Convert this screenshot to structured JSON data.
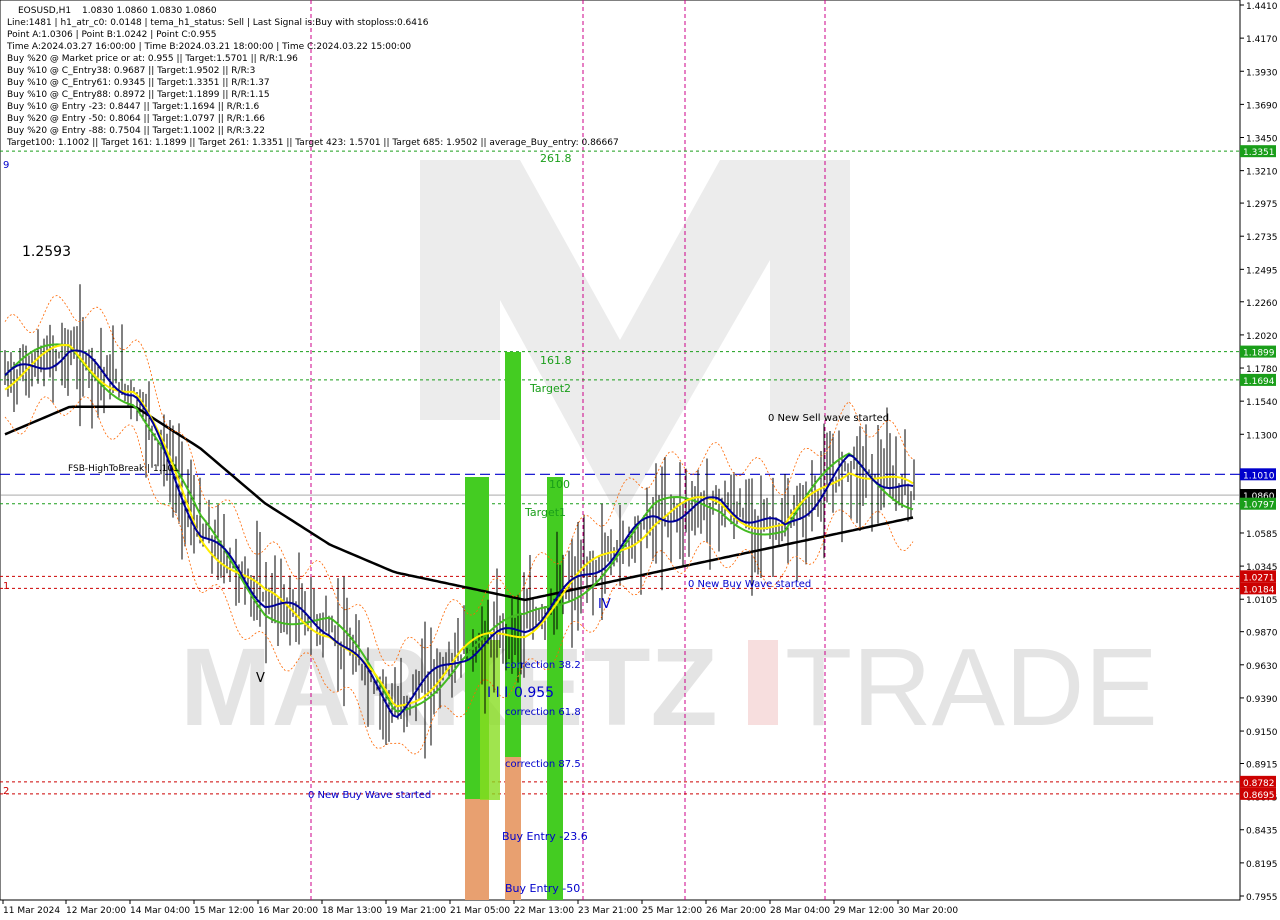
{
  "header": {
    "symbol": "EOSUSD,H1",
    "ohlc": "1.0830 1.0860 1.0830 1.0860",
    "lines": [
      "Line:1481 | h1_atr_c0: 0.0148 | tema_h1_status: Sell | Last Signal is:Buy with stoploss:0.6416",
      "Point A:1.0306 | Point B:1.0242 | Point C:0.955",
      "Time A:2024.03.27 16:00:00 | Time B:2024.03.21 18:00:00 | Time C:2024.03.22 15:00:00",
      "Buy %20 @ Market price or at: 0.955 || Target:1.5701 || R/R:1.96",
      "Buy %10 @ C_Entry38: 0.9687 || Target:1.9502 || R/R:3",
      "Buy %10 @ C_Entry61: 0.9345 || Target:1.3351 || R/R:1.37",
      "Buy %10 @ C_Entry88: 0.8972 || Target:1.1899 || R/R:1.15",
      "Buy %10 @ Entry -23: 0.8447 || Target:1.1694 || R/R:1.6",
      "Buy %20 @ Entry -50: 0.8064 || Target:1.0797 || R/R:1.66",
      "Buy %20 @ Entry -88: 0.7504 || Target:1.1002 || R/R:3.22",
      "Target100: 1.1002 || Target 161: 1.1899 || Target 261: 1.3351 || Target 423: 1.5701 || Target 685: 1.9502 || average_Buy_entry: 0.86667"
    ]
  },
  "colors": {
    "price_box": "#000000",
    "green_box": "#1a9e1a",
    "red_box": "#cc0000",
    "blue_box": "#0000cc",
    "bar_green": "#44cc22",
    "bar_orange": "#e8a070",
    "bar_lime": "#88dd22"
  },
  "price_labels": [
    {
      "value": 1.441,
      "text": "1.4410"
    },
    {
      "value": 1.417,
      "text": "1.4170"
    },
    {
      "value": 1.393,
      "text": "1.3930"
    },
    {
      "value": 1.369,
      "text": "1.3690"
    },
    {
      "value": 1.345,
      "text": "1.3450"
    },
    {
      "value": 1.321,
      "text": "1.3210"
    },
    {
      "value": 1.2975,
      "text": "1.2975"
    },
    {
      "value": 1.2735,
      "text": "1.2735"
    },
    {
      "value": 1.2495,
      "text": "1.2495"
    },
    {
      "value": 1.226,
      "text": "1.2260"
    },
    {
      "value": 1.202,
      "text": "1.2020"
    },
    {
      "value": 1.178,
      "text": "1.1780"
    },
    {
      "value": 1.154,
      "text": "1.1540"
    },
    {
      "value": 1.13,
      "text": "1.1300"
    },
    {
      "value": 1.0585,
      "text": "1.0585"
    },
    {
      "value": 1.0345,
      "text": "1.0345"
    },
    {
      "value": 1.0105,
      "text": "1.0105"
    },
    {
      "value": 0.987,
      "text": "0.9870"
    },
    {
      "value": 0.963,
      "text": "0.9630"
    },
    {
      "value": 0.939,
      "text": "0.9390"
    },
    {
      "value": 0.915,
      "text": "0.9150"
    },
    {
      "value": 0.8915,
      "text": "0.8915"
    },
    {
      "value": 0.8675,
      "text": "0.8675"
    },
    {
      "value": 0.8435,
      "text": "0.8435"
    },
    {
      "value": 0.8195,
      "text": "0.8195"
    },
    {
      "value": 0.7955,
      "text": "0.7955"
    }
  ],
  "price_boxes": [
    {
      "value": 1.3351,
      "text": "1.3351",
      "color": "green"
    },
    {
      "value": 1.1899,
      "text": "1.1899",
      "color": "green"
    },
    {
      "value": 1.1694,
      "text": "1.1694",
      "color": "green"
    },
    {
      "value": 1.101,
      "text": "1.1010",
      "color": "blue"
    },
    {
      "value": 1.086,
      "text": "1.0860",
      "color": "black"
    },
    {
      "value": 1.0797,
      "text": "1.0797",
      "color": "green"
    },
    {
      "value": 1.0271,
      "text": "1.0271",
      "color": "red"
    },
    {
      "value": 1.0184,
      "text": "1.0184",
      "color": "red"
    },
    {
      "value": 0.8782,
      "text": "0.8782",
      "color": "red"
    },
    {
      "value": 0.8695,
      "text": "0.8695",
      "color": "red"
    }
  ],
  "time_labels": [
    "11 Mar 2024",
    "12 Mar 20:00",
    "14 Mar 04:00",
    "15 Mar 12:00",
    "16 Mar 20:00",
    "18 Mar 13:00",
    "19 Mar 21:00",
    "21 Mar 05:00",
    "22 Mar 13:00",
    "23 Mar 21:00",
    "25 Mar 12:00",
    "26 Mar 20:00",
    "28 Mar 04:00",
    "29 Mar 12:00",
    "30 Mar 20:00"
  ],
  "chart_annotations": {
    "level_261": "261.8",
    "level_161": "161.8",
    "target2": "Target2",
    "level_100": "100",
    "target1": "Target1",
    "new_sell_wave": "0 New Sell wave started",
    "new_buy_wave_right": "0 New Buy Wave started",
    "new_buy_wave_left": "0 New Buy Wave started",
    "fsb": "FSB-HighToBreak | 1.101",
    "high_label": "1.2593",
    "correction_38": "correction 38.2",
    "correction_61": "correction 61.8",
    "correction_87": "correction 87.5",
    "point_c_label": "0.955",
    "buy_entry_23": "Buy Entry -23.6",
    "buy_entry_50": "Buy Entry -50",
    "wave_iv": "IV",
    "wave_v": "V",
    "left_9": "9",
    "left_1": "1",
    "left_2": "2"
  },
  "watermark": {
    "left": "MARKETZ",
    "right": "TRADE"
  },
  "chart_data": {
    "type": "line",
    "xlabel": "",
    "ylabel": "",
    "ylim": [
      0.7955,
      1.441
    ],
    "x": [
      "11 Mar 2024",
      "12 Mar 20:00",
      "14 Mar 04:00",
      "15 Mar 12:00",
      "16 Mar 20:00",
      "18 Mar 13:00",
      "19 Mar 21:00",
      "21 Mar 05:00",
      "22 Mar 13:00",
      "23 Mar 21:00",
      "25 Mar 12:00",
      "26 Mar 20:00",
      "28 Mar 04:00",
      "29 Mar 12:00",
      "30 Mar 20:00"
    ],
    "series": [
      {
        "values": [
          1.17,
          1.19,
          1.16,
          1.06,
          1.01,
          0.99,
          0.93,
          0.97,
          0.99,
          1.03,
          1.07,
          1.08,
          1.06,
          1.11,
          1.086
        ]
      },
      {
        "values": [
          1.13,
          1.15,
          1.15,
          1.12,
          1.08,
          1.05,
          1.03,
          1.02,
          1.01,
          1.02,
          1.03,
          1.04,
          1.05,
          1.06,
          1.07
        ]
      }
    ],
    "horizontal_levels": [
      1.3351,
      1.1899,
      1.1694,
      1.101,
      1.086,
      1.0797,
      1.0271,
      1.0184,
      0.8782,
      0.8695
    ]
  }
}
